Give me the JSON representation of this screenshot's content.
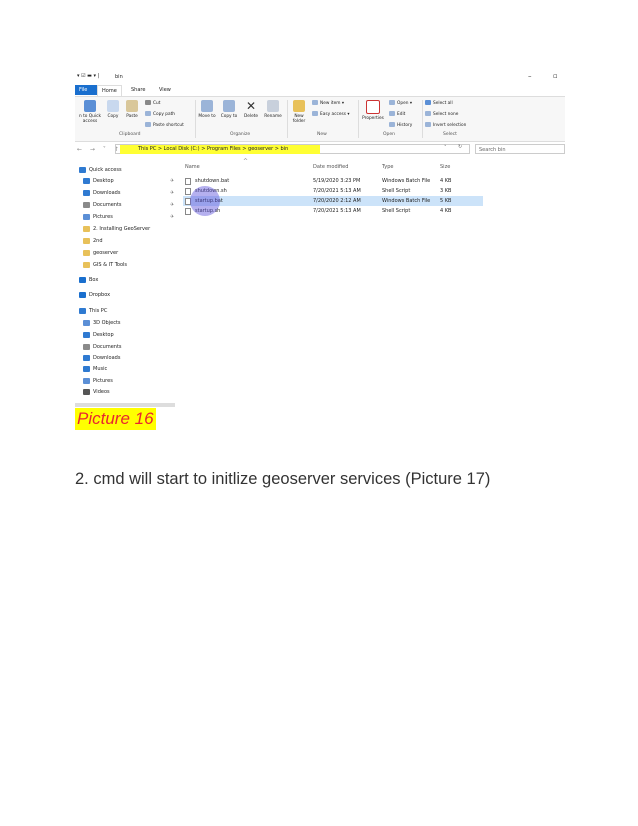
{
  "screenshot": {
    "titlebar": {
      "path": "bin"
    },
    "tabs": [
      "File",
      "Home",
      "Share",
      "View"
    ],
    "ribbon": {
      "pin_label": "n to Quick access",
      "copy_label": "Copy",
      "paste_label": "Paste",
      "cut_label": "Cut",
      "copy_path_label": "Copy path",
      "paste_shortcut_label": "Paste shortcut",
      "move_label": "Move to",
      "copyto_label": "Copy to",
      "delete_label": "Delete",
      "rename_label": "Rename",
      "new_folder_label": "New folder",
      "new_item_label": "New item",
      "easy_access_label": "Easy access",
      "properties_label": "Properties",
      "open_label": "Open",
      "edit_label": "Edit",
      "history_label": "History",
      "select_all_label": "Select all",
      "select_none_label": "Select none",
      "invert_selection_label": "Invert selection",
      "groups": [
        "Clipboard",
        "Organize",
        "New",
        "Open",
        "Select"
      ]
    },
    "address": {
      "crumbs": "This PC  >  Local Disk (C:)  >  Program Files  >  geoserver  >  bin",
      "search_placeholder": "Search bin"
    },
    "nav": [
      {
        "label": "Quick access",
        "icon": "star-icon",
        "color": "#2f7ad1"
      },
      {
        "label": "Desktop",
        "icon": "desktop-icon",
        "color": "#2f7ad1",
        "pinned": true
      },
      {
        "label": "Downloads",
        "icon": "download-icon",
        "color": "#2f7ad1",
        "pinned": true
      },
      {
        "label": "Documents",
        "icon": "document-icon",
        "color": "#8a8a8a",
        "pinned": true
      },
      {
        "label": "Pictures",
        "icon": "picture-icon",
        "color": "#5b8fd6",
        "pinned": true
      },
      {
        "label": "2. Installing GeoServer",
        "icon": "folder-icon",
        "color": "#e8c15a"
      },
      {
        "label": "2nd",
        "icon": "folder-icon",
        "color": "#e8c15a"
      },
      {
        "label": "geoserver",
        "icon": "folder-icon",
        "color": "#e8c15a"
      },
      {
        "label": "GIS & IT Tools",
        "icon": "folder-icon",
        "color": "#e8c15a"
      },
      {
        "label": "Box",
        "icon": "box-icon",
        "color": "#1a6fce"
      },
      {
        "label": "Dropbox",
        "icon": "dropbox-icon",
        "color": "#1a6fce"
      },
      {
        "label": "This PC",
        "icon": "pc-icon",
        "color": "#2f7ad1"
      },
      {
        "label": "3D Objects",
        "icon": "cube-icon",
        "color": "#5b8fd6"
      },
      {
        "label": "Desktop",
        "icon": "desktop-icon",
        "color": "#2f7ad1"
      },
      {
        "label": "Documents",
        "icon": "document-icon",
        "color": "#8a8a8a"
      },
      {
        "label": "Downloads",
        "icon": "download-icon",
        "color": "#2f7ad1"
      },
      {
        "label": "Music",
        "icon": "music-icon",
        "color": "#2f7ad1"
      },
      {
        "label": "Pictures",
        "icon": "picture-icon",
        "color": "#5b8fd6"
      },
      {
        "label": "Videos",
        "icon": "video-icon",
        "color": "#555555"
      }
    ],
    "columns": [
      "Name",
      "Date modified",
      "Type",
      "Size"
    ],
    "files": [
      {
        "name": "shutdown.bat",
        "date": "5/19/2020 3:23 PM",
        "type": "Windows Batch File",
        "size": "4 KB",
        "selected": false
      },
      {
        "name": "shutdown.sh",
        "date": "7/20/2021 5:13 AM",
        "type": "Shell Script",
        "size": "3 KB",
        "selected": false
      },
      {
        "name": "startup.bat",
        "date": "7/20/2020 2:12 AM",
        "type": "Windows Batch File",
        "size": "5 KB",
        "selected": true
      },
      {
        "name": "startup.sh",
        "date": "7/20/2021 5:13 AM",
        "type": "Shell Script",
        "size": "4 KB",
        "selected": false
      }
    ]
  },
  "caption": "Picture 16",
  "paragraph": "2. cmd will start to initlize geoserver services (Picture 17)"
}
